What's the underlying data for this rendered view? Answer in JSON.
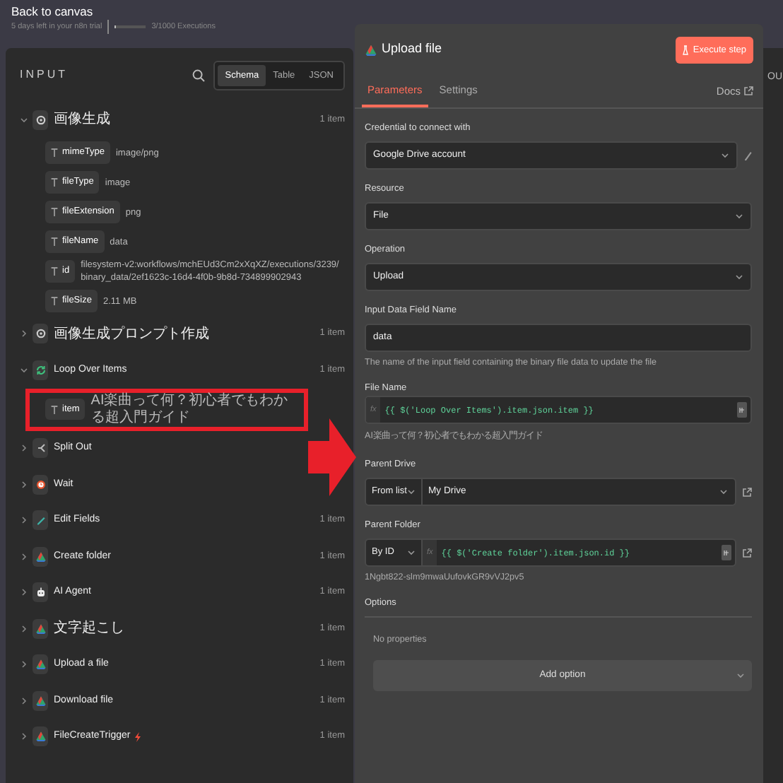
{
  "topbar": {
    "back_label": "Back to canvas",
    "trial": "5 days left in your n8n trial",
    "executions": "3/1000 Executions",
    "level": 0.05
  },
  "input_panel": {
    "title": "INPUT",
    "view_tabs": [
      {
        "label": "Schema",
        "selected": true
      },
      {
        "label": "Table",
        "selected": false
      },
      {
        "label": "JSON",
        "selected": false
      }
    ],
    "nodes": [
      {
        "name": "画像生成",
        "kind": "openai",
        "count": "1 item",
        "expanded": true,
        "trigger": false,
        "fields": [
          {
            "key": "mimeType",
            "value": "image/png",
            "highlighted": false
          },
          {
            "key": "fileType",
            "value": "image",
            "highlighted": false
          },
          {
            "key": "fileExtension",
            "value": "png",
            "highlighted": false
          },
          {
            "key": "fileName",
            "value": "data",
            "highlighted": false
          },
          {
            "key": "id",
            "value": "filesystem-v2:workflows/mchEUd3Cm2xXqXZ/executions/3239/binary_data/2ef1623c-16d4-4f0b-9b8d-734899902943",
            "highlighted": false
          },
          {
            "key": "fileSize",
            "value": "2.11 MB",
            "highlighted": false
          }
        ]
      },
      {
        "name": "画像生成プロンプト作成",
        "kind": "openai",
        "count": "1 item",
        "expanded": false,
        "trigger": false
      },
      {
        "name": "Loop Over Items",
        "kind": "loop",
        "count": "1 item",
        "expanded": true,
        "trigger": false,
        "fields": [
          {
            "key": "item",
            "value": "AI楽曲って何？初心者でもわかる超入門ガイド",
            "highlighted": true
          }
        ]
      },
      {
        "name": "Split Out",
        "kind": "split",
        "expanded": false,
        "trigger": false
      },
      {
        "name": "Wait",
        "kind": "wait",
        "expanded": false,
        "trigger": false
      },
      {
        "name": "Edit Fields",
        "kind": "edit",
        "count": "1 item",
        "expanded": false,
        "trigger": false
      },
      {
        "name": "Create folder",
        "kind": "drive",
        "count": "1 item",
        "expanded": false,
        "trigger": false
      },
      {
        "name": "AI Agent",
        "kind": "agent",
        "count": "1 item",
        "expanded": false,
        "trigger": false
      },
      {
        "name": "文字起こし",
        "kind": "drive",
        "count": "1 item",
        "expanded": false,
        "trigger": false
      },
      {
        "name": "Upload a file",
        "kind": "drive",
        "count": "1 item",
        "expanded": false,
        "trigger": false
      },
      {
        "name": "Download file",
        "kind": "drive",
        "count": "1 item",
        "expanded": false,
        "trigger": false
      },
      {
        "name": "FileCreateTrigger",
        "kind": "drive",
        "count": "1 item",
        "expanded": false,
        "trigger": true
      }
    ]
  },
  "node_panel": {
    "title": "Upload file",
    "execute_label": "Execute step",
    "tabs": [
      {
        "label": "Parameters",
        "selected": true
      },
      {
        "label": "Settings",
        "selected": false
      }
    ],
    "docs_label": "Docs",
    "params": [
      {
        "kind": "credential",
        "label": "Credential to connect with",
        "value": "Google Drive account"
      },
      {
        "kind": "select",
        "label": "Resource",
        "value": "File"
      },
      {
        "kind": "select",
        "label": "Operation",
        "value": "Upload"
      },
      {
        "kind": "input",
        "label": "Input Data Field Name",
        "value": "data",
        "hint": "The name of the input field containing the binary file data to update the file"
      },
      {
        "kind": "expression",
        "label": "File Name",
        "fx": "fx",
        "value": "{{ $('Loop Over Items').item.json.item }}",
        "hint": "AI楽曲って何？初心者でもわかる超入門ガイド"
      },
      {
        "kind": "resource",
        "label": "Parent Drive",
        "mode": "From list",
        "value": "My Drive"
      },
      {
        "kind": "resource_expression",
        "label": "Parent Folder",
        "mode": "By ID",
        "fx": "fx",
        "value": "{{ $('Create folder').item.json.id }}",
        "hint": "1Ngbt822-slm9mwaUufovkGR9vVJ2pv5"
      }
    ],
    "options": {
      "label": "Options",
      "empty_text": "No properties",
      "add_label": "Add option"
    }
  },
  "output_panel": {
    "title": "OU"
  }
}
